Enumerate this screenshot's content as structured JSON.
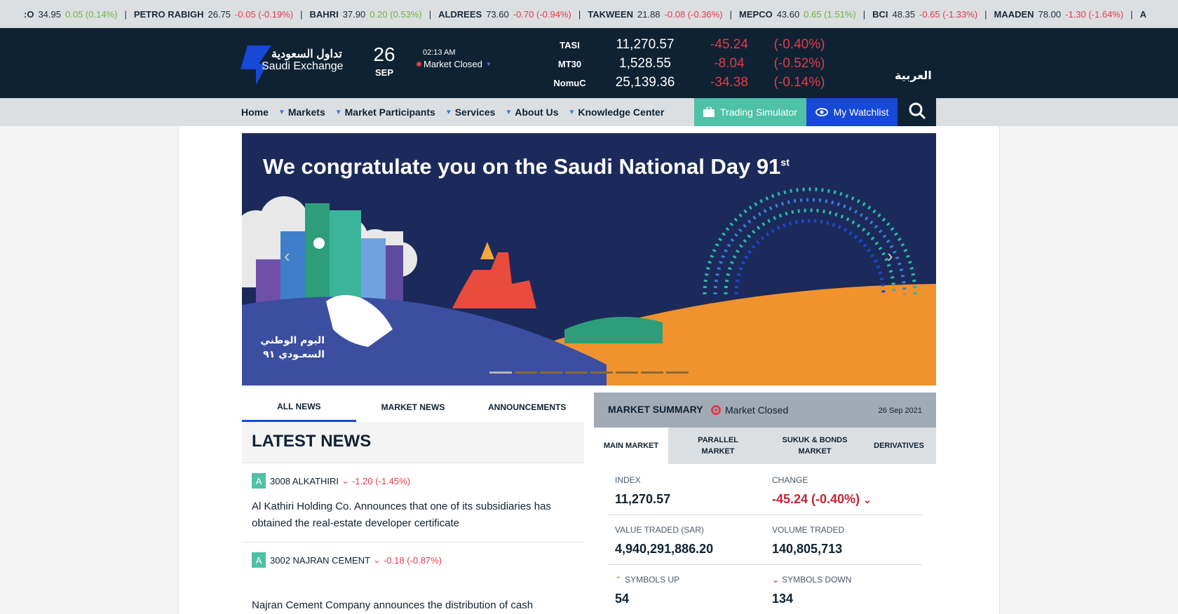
{
  "ticker": [
    {
      "symbol": ":O",
      "price": "34.95",
      "change": "0.05 (0.14%)",
      "direction": "up"
    },
    {
      "symbol": "PETRO RABIGH",
      "price": "26.75",
      "change": "-0.05 (-0.19%)",
      "direction": "down"
    },
    {
      "symbol": "BAHRI",
      "price": "37.90",
      "change": "0.20 (0.53%)",
      "direction": "up"
    },
    {
      "symbol": "ALDREES",
      "price": "73.60",
      "change": "-0.70 (-0.94%)",
      "direction": "down"
    },
    {
      "symbol": "TAKWEEN",
      "price": "21.88",
      "change": "-0.08 (-0.36%)",
      "direction": "down"
    },
    {
      "symbol": "MEPCO",
      "price": "43.60",
      "change": "0.65 (1.51%)",
      "direction": "up"
    },
    {
      "symbol": "BCI",
      "price": "48.35",
      "change": "-0.65 (-1.33%)",
      "direction": "down"
    },
    {
      "symbol": "MAADEN",
      "price": "78.00",
      "change": "-1.30 (-1.64%)",
      "direction": "down"
    },
    {
      "symbol": "A",
      "price": "",
      "change": "",
      "direction": "down"
    }
  ],
  "ticker_separator": "|",
  "header": {
    "logo_ar": "تداول السعودية",
    "logo_en": "Saudi Exchange",
    "day": "26",
    "month": "SEP",
    "time": "02:13 AM",
    "market_status": "Market Closed",
    "indices": [
      {
        "name": "TASI",
        "value": "11,270.57",
        "change": "-45.24",
        "percent": "(-0.40%)"
      },
      {
        "name": "MT30",
        "value": "1,528.55",
        "change": "-8.04",
        "percent": "(-0.52%)"
      },
      {
        "name": "NomuC",
        "value": "25,139.36",
        "change": "-34.38",
        "percent": "(-0.14%)"
      }
    ],
    "language": "العربية"
  },
  "nav": {
    "items": [
      "Home",
      "Markets",
      "Market Participants",
      "Services",
      "About Us",
      "Knowledge Center"
    ],
    "trading_simulator": "Trading Simulator",
    "my_watchlist": "My Watchlist"
  },
  "banner": {
    "title": "We congratulate you on the Saudi National Day 91",
    "title_sup": "st",
    "logo_text_line1": "اليوم الوطني",
    "logo_text_line2": "السعـودي ٩١",
    "slide_count": 8,
    "active_slide": 0
  },
  "news": {
    "tabs": [
      "ALL NEWS",
      "MARKET NEWS",
      "ANNOUNCEMENTS"
    ],
    "active_tab": 0,
    "heading": "LATEST NEWS",
    "items": [
      {
        "badge": "A",
        "symbol": "3008 ALKATHIRI",
        "change": "-1.20 (-1.45%)",
        "text": "Al Kathiri Holding Co. Announces that one of its subsidiaries has obtained the real-estate developer certificate"
      },
      {
        "badge": "A",
        "symbol": "3002 NAJRAN CEMENT",
        "change": "-0.18 (-0.87%)",
        "text": "Najran Cement Company announces the distribution of cash"
      }
    ]
  },
  "market_summary": {
    "title": "MARKET SUMMARY",
    "status": "Market Closed",
    "date": "26 Sep 2021",
    "tabs": [
      "MAIN MARKET",
      "PARALLEL MARKET",
      "SUKUK & BONDS MARKET",
      "DERIVATIVES"
    ],
    "active_tab": 0,
    "index_label": "INDEX",
    "index_value": "11,270.57",
    "change_label": "CHANGE",
    "change_value": "-45.24 (-0.40%)",
    "value_traded_label": "VALUE TRADED (SAR)",
    "value_traded": "4,940,291,886.20",
    "volume_traded_label": "VOLUME TRADED",
    "volume_traded": "140,805,713",
    "symbols_up_label": "SYMBOLS UP",
    "symbols_up": "54",
    "symbols_down_label": "SYMBOLS DOWN",
    "symbols_down": "134"
  },
  "colors": {
    "navy": "#0e2233",
    "up": "#6cb33f",
    "down": "#e33b4b",
    "accent_blue": "#1749d6",
    "teal": "#4fc1a6"
  }
}
